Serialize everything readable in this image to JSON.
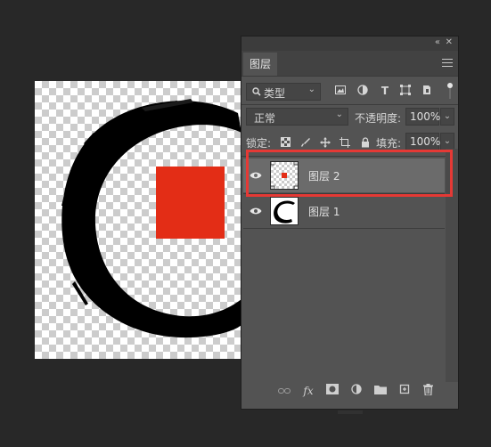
{
  "canvas": {
    "brush_icon": "ink-circle-brush-stroke",
    "red_square_color": "#e32d16"
  },
  "panel": {
    "collapse_glyph": "«",
    "close_glyph": "✕",
    "tab_label": "图层",
    "filter": {
      "icon": "search-icon",
      "label": "类型",
      "chevron": "⌄"
    },
    "filter_icons": [
      "image-icon",
      "adjustment-icon",
      "text-icon",
      "shape-icon",
      "smart-object-icon"
    ],
    "blend_mode": "正常",
    "opacity_label": "不透明度:",
    "opacity_value": "100%",
    "lock_label": "锁定:",
    "lock_icons": [
      "lock-transparent-icon",
      "lock-paint-icon",
      "lock-move-icon",
      "lock-artboard-icon",
      "lock-all-icon"
    ],
    "fill_label": "填充:",
    "fill_value": "100%",
    "layers": [
      {
        "name": "图层 2",
        "selected": true,
        "visible": true
      },
      {
        "name": "图层 1",
        "selected": false,
        "visible": true
      }
    ],
    "bottom_icons": [
      "link-icon",
      "fx-icon",
      "mask-icon",
      "adjustment-layer-icon",
      "group-folder-icon",
      "new-layer-icon",
      "trash-icon"
    ],
    "highlight_color": "#e53935"
  }
}
